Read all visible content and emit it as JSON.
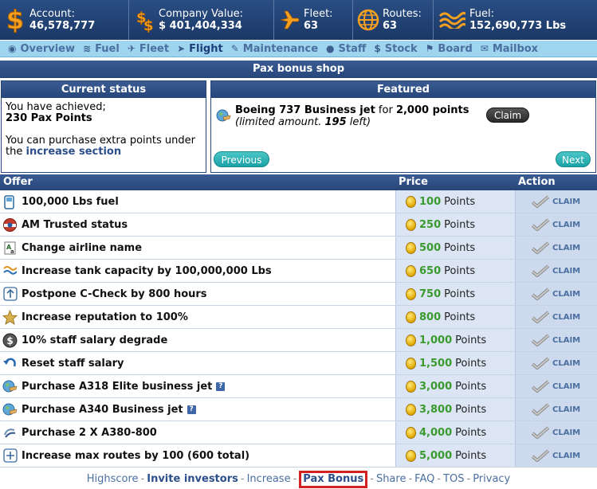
{
  "stats": [
    {
      "icon": "dollar-icon",
      "label": "Account:",
      "value": "46,578,777"
    },
    {
      "icon": "money-stack-icon",
      "label": "Company Value:",
      "value": "$ 401,404,334"
    },
    {
      "icon": "airplane-icon",
      "label": "Fleet:",
      "value": "63"
    },
    {
      "icon": "globe-icon",
      "label": "Routes:",
      "value": "63"
    },
    {
      "icon": "fuel-waves-icon",
      "label": "Fuel:",
      "value": "152,690,773 Lbs"
    }
  ],
  "nav": [
    {
      "icon": "overview-icon",
      "label": "Overview"
    },
    {
      "icon": "fuel-icon",
      "label": "Fuel"
    },
    {
      "icon": "fleet-icon",
      "label": "Fleet"
    },
    {
      "icon": "flight-icon",
      "label": "Flight"
    },
    {
      "icon": "wrench-icon",
      "label": "Maintenance"
    },
    {
      "icon": "staff-icon",
      "label": "Staff"
    },
    {
      "icon": "stock-icon",
      "label": "Stock"
    },
    {
      "icon": "board-icon",
      "label": "Board"
    },
    {
      "icon": "mailbox-icon",
      "label": "Mailbox"
    }
  ],
  "page_title": "Pax bonus shop",
  "status": {
    "heading": "Current status",
    "line1": "You have achieved;",
    "points": "230 Pax Points",
    "line2": "You can purchase extra points under",
    "line3_prefix": "the",
    "link": "increase section"
  },
  "featured": {
    "heading": "Featured",
    "item": "Boeing 737 Business jet",
    "for_text": "for",
    "points": "2,000 points",
    "note_prefix": "(limited amount.",
    "note_count": "195",
    "note_suffix": "left)",
    "claim_label": "Claim",
    "prev_label": "Previous",
    "next_label": "Next"
  },
  "table": {
    "headers": {
      "offer": "Offer",
      "price": "Price",
      "action": "Action"
    },
    "points_label": "Points",
    "claim_label": "CLAIM",
    "rows": [
      {
        "icon": "fuel-pump-icon",
        "offer": "100,000 Lbs fuel",
        "price": "100",
        "help": ""
      },
      {
        "icon": "trusted-badge-icon",
        "offer": "AM Trusted status",
        "price": "250",
        "help": ""
      },
      {
        "icon": "rename-icon",
        "offer": "Change airline name",
        "price": "500",
        "help": ""
      },
      {
        "icon": "tank-waves-icon",
        "offer": "Increase tank capacity by 100,000,000 Lbs",
        "price": "650",
        "help": ""
      },
      {
        "icon": "arrow-up-icon",
        "offer": "Postpone C-Check by 800 hours",
        "price": "750",
        "help": ""
      },
      {
        "icon": "star-icon",
        "offer": "Increase reputation to 100%",
        "price": "800",
        "help": ""
      },
      {
        "icon": "dollar-coin-icon",
        "offer": "10% staff salary degrade",
        "price": "1,000",
        "help": ""
      },
      {
        "icon": "undo-arrow-icon",
        "offer": "Reset staff salary",
        "price": "1,500",
        "help": ""
      },
      {
        "icon": "globe-plane-icon",
        "offer": "Purchase A318 Elite business jet",
        "price": "3,000",
        "help": "?"
      },
      {
        "icon": "globe-plane-icon",
        "offer": "Purchase A340 Business jet",
        "price": "3,800",
        "help": "?"
      },
      {
        "icon": "swirl-icon",
        "offer": "Purchase 2 X A380-800",
        "price": "4,000",
        "help": ""
      },
      {
        "icon": "plus-icon",
        "offer": "Increase max routes by 100 (600 total)",
        "price": "5,000",
        "help": ""
      }
    ]
  },
  "footer": {
    "links": [
      "Highscore",
      "Invite investors",
      "Increase",
      "Pax Bonus",
      "Share",
      "FAQ",
      "TOS",
      "Privacy"
    ],
    "separator": "-"
  },
  "colors": {
    "accent": "#27467a",
    "nav_bg": "#9fd4ee",
    "points_green": "#3a9a2e",
    "highlight_red": "#d32020"
  }
}
